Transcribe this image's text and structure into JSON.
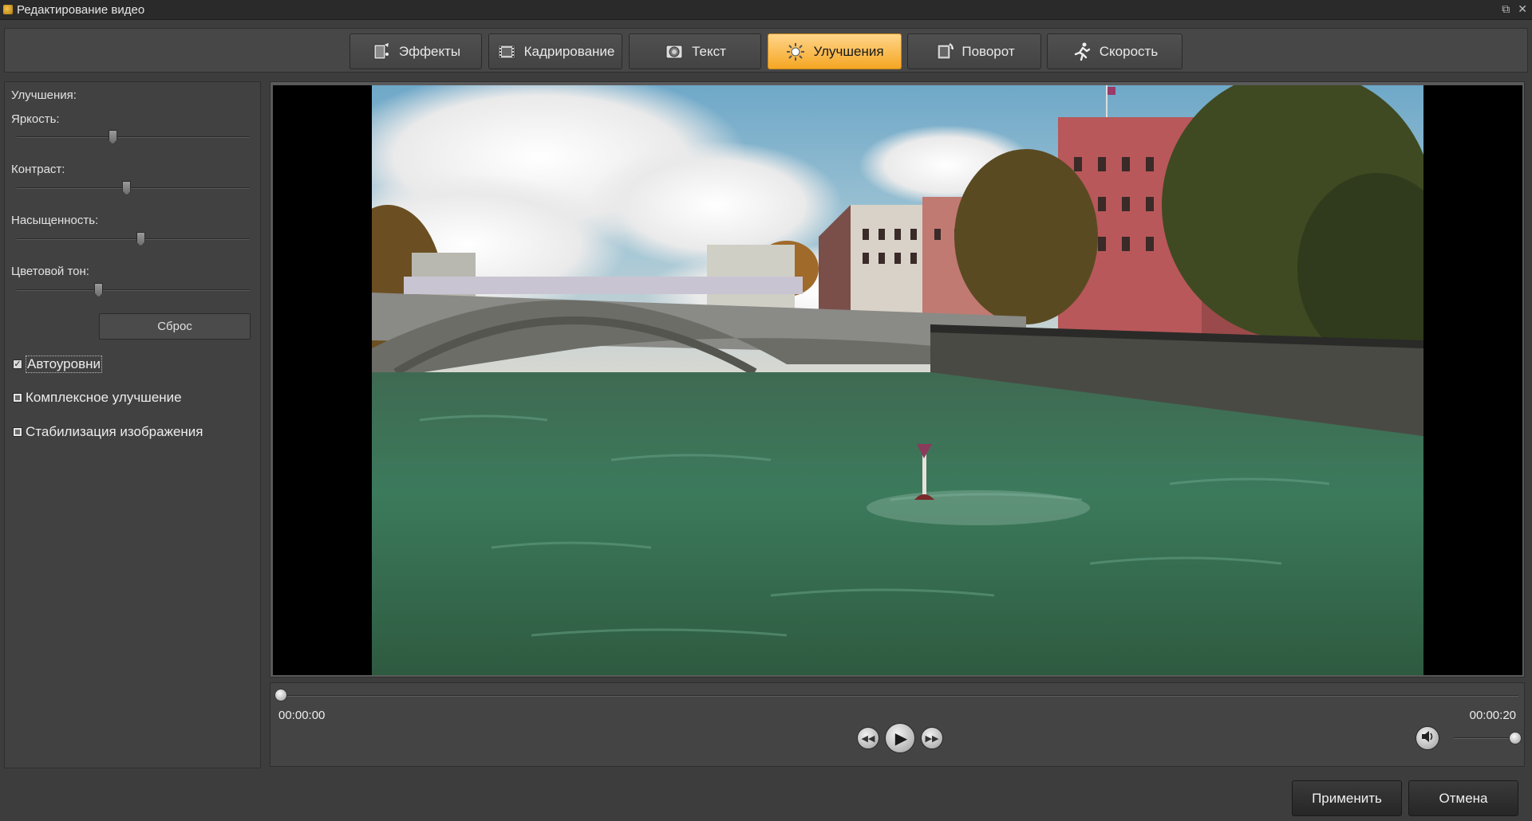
{
  "window": {
    "title": "Редактирование видео"
  },
  "tabs": [
    {
      "label": "Эффекты",
      "icon": "effects-icon",
      "active": false
    },
    {
      "label": "Кадрирование",
      "icon": "crop-film-icon",
      "active": false
    },
    {
      "label": "Текст",
      "icon": "text-camera-icon",
      "active": false
    },
    {
      "label": "Улучшения",
      "icon": "sun-brightness-icon",
      "active": true
    },
    {
      "label": "Поворот",
      "icon": "rotate-film-icon",
      "active": false
    },
    {
      "label": "Скорость",
      "icon": "running-man-icon",
      "active": false
    }
  ],
  "enhancements": {
    "heading": "Улучшения:",
    "sliders": [
      {
        "label": "Яркость:",
        "value": 0.41
      },
      {
        "label": "Контраст:",
        "value": 0.47
      },
      {
        "label": "Насыщенность:",
        "value": 0.53
      },
      {
        "label": "Цветовой тон:",
        "value": 0.35
      }
    ],
    "reset_label": "Сброс",
    "checkboxes": [
      {
        "label": "Автоуровни",
        "checked": true
      },
      {
        "label": "Комплексное улучшение",
        "checked": false
      },
      {
        "label": "Стабилизация изображения",
        "checked": false
      }
    ]
  },
  "player": {
    "current_time": "00:00:00",
    "total_time": "00:00:20",
    "progress": 0,
    "volume": 1.0,
    "colors": {
      "accent": "#f5a623",
      "background": "#3d3d3d"
    }
  },
  "actions": {
    "apply_label": "Применить",
    "cancel_label": "Отмена"
  }
}
